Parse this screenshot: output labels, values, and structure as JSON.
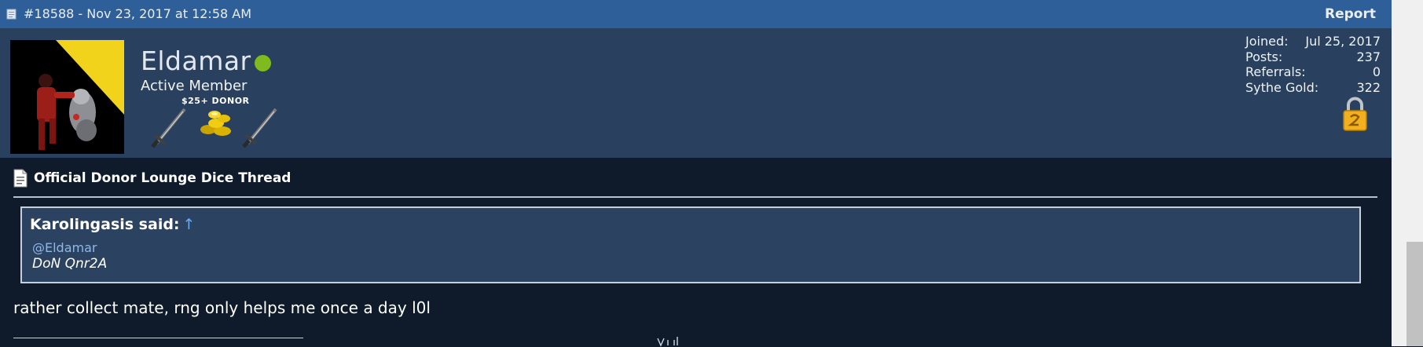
{
  "header": {
    "post_meta": "#18588 - Nov 23, 2017 at 12:58 AM",
    "report_label": "Report"
  },
  "user": {
    "name": "Eldamar",
    "title": "Active Member",
    "donor_label": "$25+ DONOR",
    "online_color": "#7fbb1f",
    "badge_icons": [
      "sword-icon",
      "gold-coins-icon",
      "sword-icon"
    ],
    "lock_icon": "padlock-icon"
  },
  "stats": [
    {
      "label": "Joined:",
      "value": "Jul 25, 2017"
    },
    {
      "label": "Posts:",
      "value": "237"
    },
    {
      "label": "Referrals:",
      "value": "0"
    },
    {
      "label": "Sythe Gold:",
      "value": "322"
    }
  ],
  "thread": {
    "title": "Official Donor Lounge Dice Thread"
  },
  "quote": {
    "author": "Karolingasis said:",
    "arrow": "↑",
    "mention": "@Eldamar",
    "text": "DoN Qnr2A"
  },
  "message": {
    "text": "rather collect mate, rng only helps me once a day l0l"
  },
  "colors": {
    "header_bg": "#2f5f99",
    "userinfo_bg": "#29405f",
    "content_bg": "#0f1b2b",
    "quote_bg": "#2b4360",
    "link": "#8fb6ea"
  }
}
